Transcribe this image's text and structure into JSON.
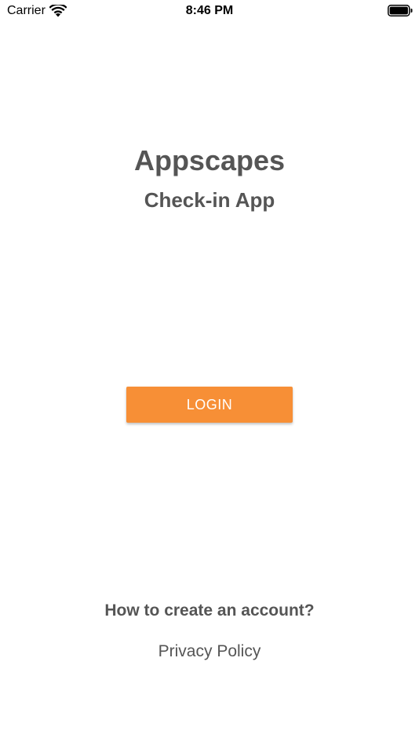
{
  "status_bar": {
    "carrier": "Carrier",
    "time": "8:46 PM",
    "wifi_icon": "wifi-icon",
    "battery_icon": "battery-icon"
  },
  "header": {
    "title": "Appscapes",
    "subtitle": "Check-in App"
  },
  "login": {
    "label": "LOGIN"
  },
  "links": {
    "create_account": "How to create an account?",
    "privacy_policy": "Privacy Policy"
  },
  "colors": {
    "accent": "#f78f36",
    "text": "#555555",
    "background": "#ffffff"
  }
}
